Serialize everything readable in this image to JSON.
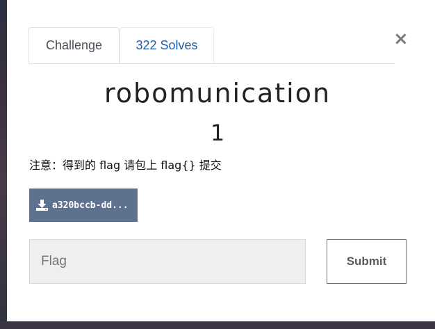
{
  "modal": {
    "close_symbol": "×",
    "tabs": [
      {
        "label": "Challenge"
      },
      {
        "label": "322 Solves"
      }
    ],
    "challenge": {
      "name": "robomunication",
      "value": "1",
      "description": "注意：得到的 flag 请包上 flag{} 提交",
      "file": {
        "label": "a320bccb-dd...",
        "icon": "download-icon"
      }
    },
    "form": {
      "flag_placeholder": "Flag",
      "flag_value": "",
      "submit_label": "Submit"
    }
  },
  "colors": {
    "tab_active_text": "#495057",
    "tab_link_text": "#1f5ea8",
    "file_button_bg": "#5e7290",
    "input_bg": "#efefef"
  }
}
